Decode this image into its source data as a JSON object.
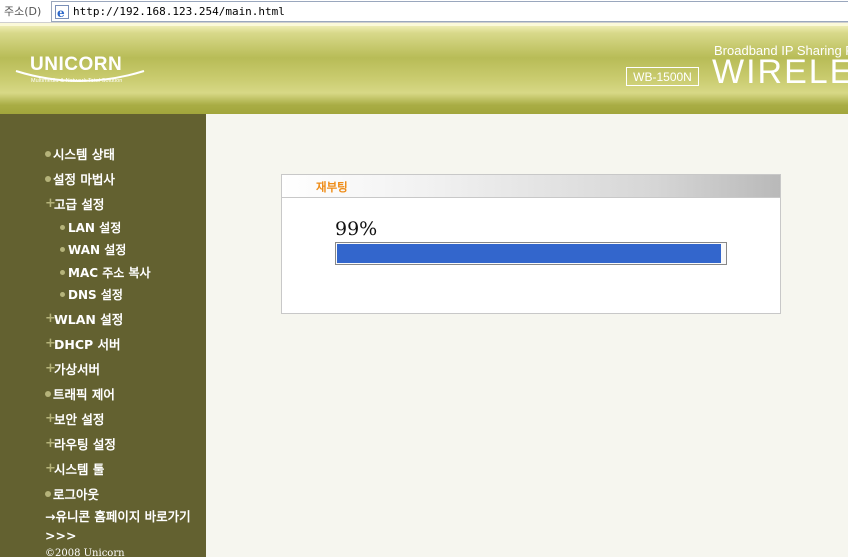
{
  "address_bar": {
    "label": "주소(D)",
    "url": "http://192.168.123.254/main.html"
  },
  "header": {
    "logo_text": "UNICORN",
    "logo_subtitle": "Multimedia & Network Total Solution",
    "model": "WB-1500N",
    "tagline": "Broadband IP Sharing R",
    "product": "WIRELE"
  },
  "sidebar": {
    "items": [
      {
        "label": "시스템 상태",
        "marker": "dot"
      },
      {
        "label": "설정 마법사",
        "marker": "dot"
      },
      {
        "label": "고급 설정",
        "marker": "plus"
      },
      {
        "label": "LAN 설정",
        "marker": "dot",
        "sub": true
      },
      {
        "label": "WAN 설정",
        "marker": "dot",
        "sub": true
      },
      {
        "label": "MAC 주소 복사",
        "marker": "dot",
        "sub": true
      },
      {
        "label": "DNS 설정",
        "marker": "dot",
        "sub": true
      },
      {
        "label": "WLAN 설정",
        "marker": "plus"
      },
      {
        "label": "DHCP 서버",
        "marker": "plus"
      },
      {
        "label": "가상서버",
        "marker": "plus"
      },
      {
        "label": "트래픽 제어",
        "marker": "dot"
      },
      {
        "label": "보안 설정",
        "marker": "plus"
      },
      {
        "label": "라우팅 설정",
        "marker": "plus"
      },
      {
        "label": "시스템 툴",
        "marker": "plus"
      },
      {
        "label": "로그아웃",
        "marker": "dot"
      }
    ],
    "home_link": "→유니콘 홈페이지 바로가기>>>",
    "copyright": "©2008 Unicorn"
  },
  "reboot_panel": {
    "title": "재부팅",
    "percent_text": "99%",
    "progress": 0.99
  },
  "colors": {
    "sidebar_bg": "#636130",
    "title_orange": "#ee8c17",
    "progress_blue": "#3366cc"
  }
}
